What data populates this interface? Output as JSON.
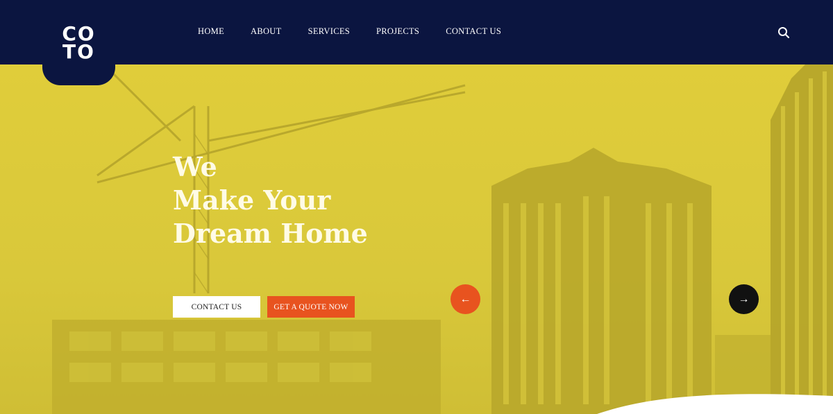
{
  "logo": {
    "line1": "CO",
    "line2": "TO"
  },
  "nav": {
    "items": [
      {
        "label": "HOME"
      },
      {
        "label": "ABOUT"
      },
      {
        "label": "SERVICES"
      },
      {
        "label": "PROJECTS"
      },
      {
        "label": "CONTACT US"
      }
    ]
  },
  "icons": {
    "search": "search-icon",
    "prev": "arrow-left-icon",
    "next": "arrow-right-icon"
  },
  "hero": {
    "headline": [
      "We",
      "Make Your",
      "Dream Home"
    ],
    "buttons": {
      "contact": "CONTACT US",
      "quote": "GET A QUOTE NOW"
    },
    "prev_symbol": "←",
    "next_symbol": "→"
  },
  "colors": {
    "header_bg": "#0b1540",
    "hero_tint": "#d9c83a",
    "accent": "#e8531f",
    "dark_button": "#111111"
  }
}
